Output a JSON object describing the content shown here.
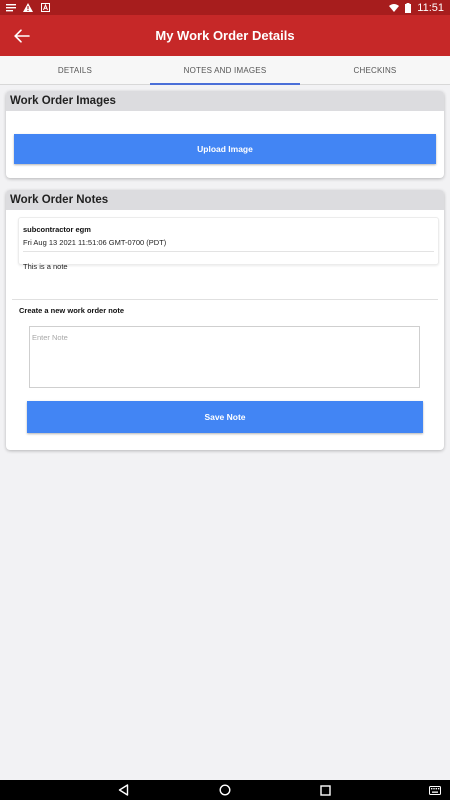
{
  "status_bar": {
    "time": "11:51",
    "icons": [
      "notification-icon",
      "warning-icon",
      "app-a-icon",
      "wifi-icon",
      "battery-icon"
    ]
  },
  "app_bar": {
    "title": "My Work Order Details",
    "back_icon": "arrow-left-icon"
  },
  "tabs": [
    {
      "label": "DETAILS",
      "active": false
    },
    {
      "label": "NOTES AND IMAGES",
      "active": true
    },
    {
      "label": "CHECKINS",
      "active": false
    }
  ],
  "images_section": {
    "title": "Work Order Images",
    "upload_label": "Upload Image"
  },
  "notes_section": {
    "title": "Work Order Notes",
    "notes": [
      {
        "author": "subcontractor egm",
        "date": "Fri Aug 13 2021 11:51:06 GMT-0700 (PDT)",
        "body": "This is a note"
      }
    ],
    "create_label": "Create a new work order note",
    "input_placeholder": "Enter Note",
    "input_value": "",
    "save_label": "Save Note"
  },
  "nav_bar": {
    "buttons": [
      "back-triangle-icon",
      "home-circle-icon",
      "recents-square-icon",
      "keyboard-icon"
    ]
  },
  "colors": {
    "app_bar": "#c62828",
    "status_bar": "#a71d1d",
    "button": "#4285f4",
    "tab_indicator": "#4a6fd8"
  }
}
